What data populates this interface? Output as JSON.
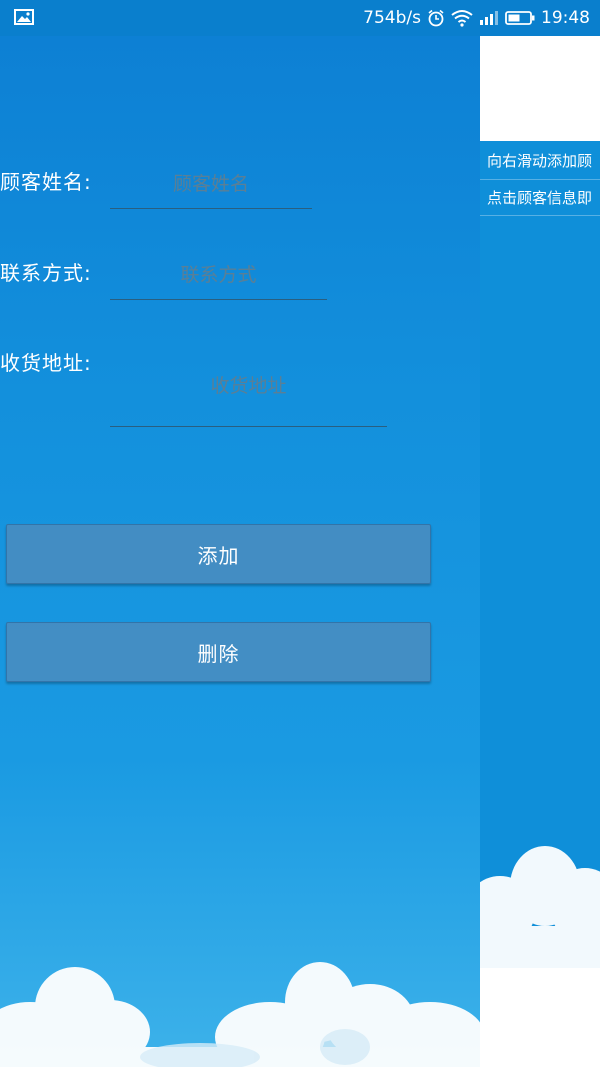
{
  "status_bar": {
    "speed": "754b/s",
    "time": "19:48",
    "icons": [
      "gallery-icon",
      "alarm-icon",
      "wifi-icon",
      "signal-icon",
      "battery-icon"
    ]
  },
  "form": {
    "name_label": "顾客姓名:",
    "name_placeholder": "顾客姓名",
    "phone_label": "联系方式:",
    "phone_placeholder": "联系方式",
    "address_label": "收货地址:",
    "address_placeholder": "收货地址"
  },
  "buttons": {
    "add_label": "添加",
    "delete_label": "删除"
  },
  "side_panel": {
    "tip_swipe": "向右滑动添加顾",
    "tip_click": "点击顾客信息即"
  },
  "colors": {
    "status_bar": "#0a7fcd",
    "background": "#1390dc",
    "button": "#4b8cbe",
    "placeholder": "#5a7f96"
  }
}
